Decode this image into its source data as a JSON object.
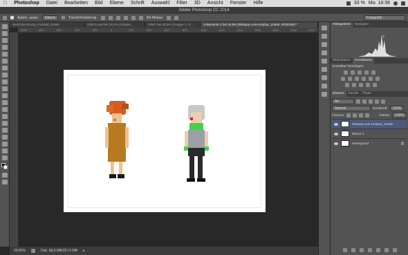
{
  "menubar": {
    "apple": "",
    "app": "Photoshop",
    "items": [
      "Datei",
      "Bearbeiten",
      "Bild",
      "Ebene",
      "Schrift",
      "Auswahl",
      "Filter",
      "3D",
      "Ansicht",
      "Fenster",
      "Hilfe"
    ],
    "battery": "33 %",
    "clock": "Mo. 18:36"
  },
  "window": {
    "title": "Adobe Photoshop CC 2014"
  },
  "options": {
    "autoselect": "Autom. ausw.:",
    "autoselect_target": "Ebene",
    "transform": "Transformationsrg.",
    "mode3d": "3D-Modus:",
    "workspace": "Fotografie"
  },
  "tabs": [
    {
      "label": "Weichzeichnung_Painball_Zotele",
      "active": false
    },
    {
      "label": "Glitch1.psd bei 33,3% (Gruppe...",
      "active": false
    },
    {
      "label": "Glitch bei 33,3% (Gruppe 1, R...",
      "active": false
    },
    {
      "label": "Unbenannt-1 bei 29,8% (Minipop-Lets-Holubar_Zotele, RGB/16#) *",
      "active": true
    }
  ],
  "ruler_ticks": [
    "1000",
    "800",
    "600",
    "400",
    "200",
    "0",
    "200",
    "400",
    "600",
    "800",
    "1000",
    "1200",
    "1400",
    "1600",
    "1800",
    "2000",
    "2200"
  ],
  "status": {
    "zoom": "29,82%",
    "doc": "Dok: 98,8 MB/257,0 MB"
  },
  "panels": {
    "top_tabs": [
      "Histogramm",
      "Navigator"
    ],
    "adj_tabs": [
      "Bibliotheken",
      "Korrekturen"
    ],
    "adj_title": "Korrektur hinzufügen",
    "layer_tabs": [
      "Ebenen",
      "Kanäle",
      "Pfade"
    ],
    "filter_kind": "Art",
    "blend": "Normal",
    "opacity_label": "Deckkraft:",
    "opacity": "100%",
    "lock_label": "Fixieren:",
    "fill_label": "Fläche:",
    "fill": "100%",
    "layers": [
      {
        "name": "Minipop-Lets-Holubar_Zotele",
        "selected": true
      },
      {
        "name": "Ebene 3",
        "selected": false
      },
      {
        "name": "Hintergrund",
        "selected": false
      }
    ]
  },
  "colors": {
    "hair_red": "#d65b1e",
    "dress_brown": "#b87a20",
    "skin": "#f0c090",
    "grey_hair": "#c8c8c8",
    "green": "#3fd34a",
    "dark": "#1a1a1a"
  }
}
